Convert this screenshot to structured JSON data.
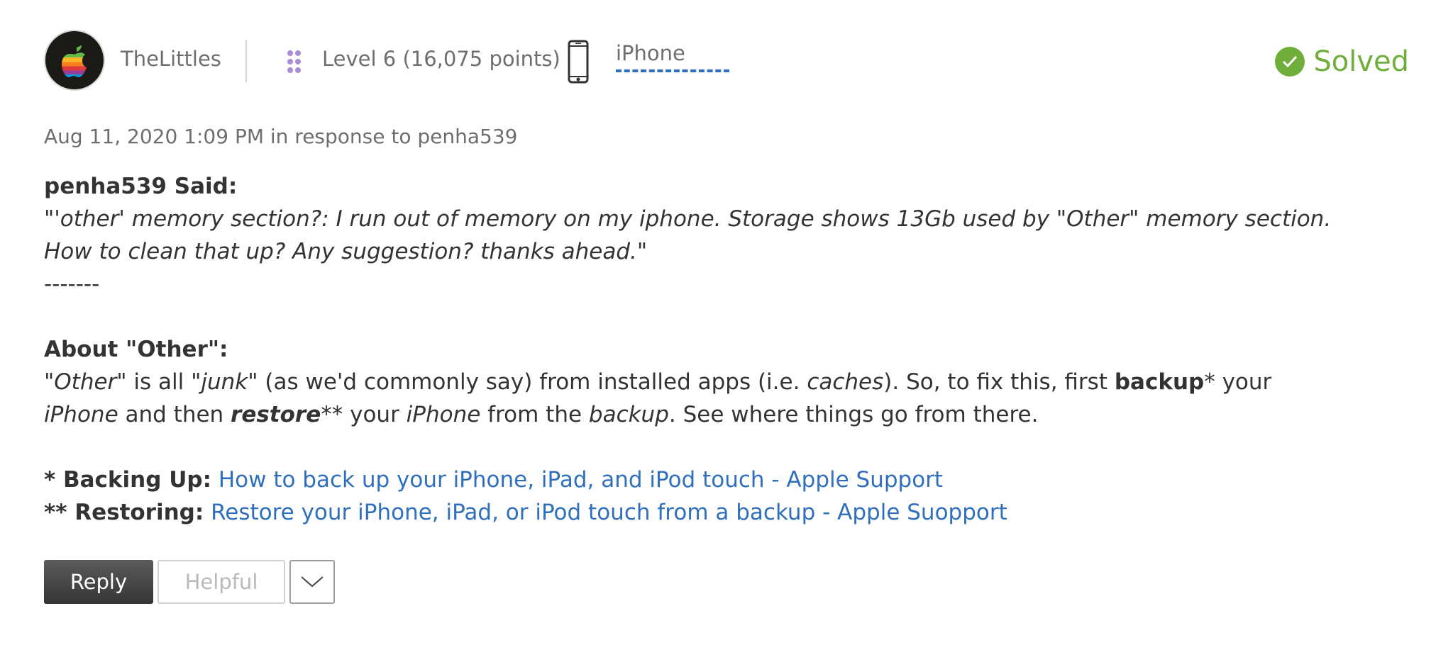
{
  "author": {
    "name": "TheLittles",
    "level": "Level 6",
    "points": "(16,075 points)"
  },
  "device": {
    "label": "iPhone"
  },
  "status": {
    "label": "Solved",
    "color": "#6fae3b"
  },
  "meta": {
    "timestamp": "Aug 11, 2020 1:09 PM in response to penha539"
  },
  "post": {
    "quote_heading": "penha539 Said:",
    "quote_open": "\"",
    "quote_text": "'other' memory section?: I run out of memory on my iphone. Storage shows 13Gb used by \"Other\" memory section. How to clean that up? Any suggestion? thanks ahead.",
    "quote_close": "\"",
    "separator": "-------",
    "about_heading": "About \"Other\":",
    "about": {
      "t1": "\"",
      "t2": "Other",
      "t3": "\" is all \"",
      "t4": "junk",
      "t5": "\" (as we'd commonly say) from installed apps (i.e. ",
      "t6": "caches",
      "t7": "). So, to fix this, first ",
      "t8": "backup",
      "t9": "* your ",
      "t10": "iPhone",
      "t11": " and then ",
      "t12": "restore",
      "t13": "** your ",
      "t14": "iPhone",
      "t15": " from the ",
      "t16": "backup",
      "t17": ". See where things go from there."
    },
    "backup_label": "* Backing Up:",
    "backup_link": "How to back up your iPhone, iPad, and iPod touch - Apple Support",
    "restore_label": "** Restoring:",
    "restore_link": "Restore your iPhone, iPad, or iPod touch from a backup - Apple Suopport"
  },
  "actions": {
    "reply": "Reply",
    "helpful": "Helpful"
  },
  "colors": {
    "link": "#2f6fbd",
    "text": "#333333",
    "muted": "#6e6e6e"
  }
}
